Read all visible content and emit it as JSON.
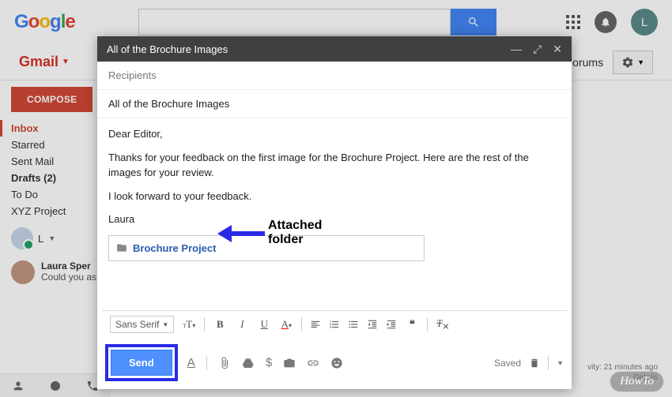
{
  "logo_text": "Google",
  "gmail_label": "Gmail",
  "compose_button": "COMPOSE",
  "folders": [
    {
      "label": "Inbox",
      "active": true,
      "bold": false
    },
    {
      "label": "Starred",
      "active": false,
      "bold": false
    },
    {
      "label": "Sent Mail",
      "active": false,
      "bold": false
    },
    {
      "label": "Drafts (2)",
      "active": false,
      "bold": true
    },
    {
      "label": "To Do",
      "active": false,
      "bold": false
    },
    {
      "label": "XYZ Project",
      "active": false,
      "bold": false
    }
  ],
  "hangouts_user": "L",
  "chat": {
    "name": "Laura Sper",
    "preview": "Could you as"
  },
  "nav_right": {
    "forums": "Forums"
  },
  "avatar_initial": "L",
  "compose": {
    "title": "All of the Brochure Images",
    "recipients_placeholder": "Recipients",
    "subject": "All of the Brochure Images",
    "greeting": "Dear Editor,",
    "para1": "Thanks for your feedback on the first image for the Brochure Project. Here are the rest of the images for your review.",
    "para2": "I look forward to your feedback.",
    "signature": "Laura",
    "attachment_name": "Brochure Project",
    "font_family": "Sans Serif",
    "send_label": "Send",
    "saved_label": "Saved"
  },
  "annotation": {
    "line1": "Attached",
    "line2": "folder"
  },
  "activity": {
    "line1": "vity: 21 minutes ago",
    "line2": "Details"
  },
  "badge": "HowTo"
}
